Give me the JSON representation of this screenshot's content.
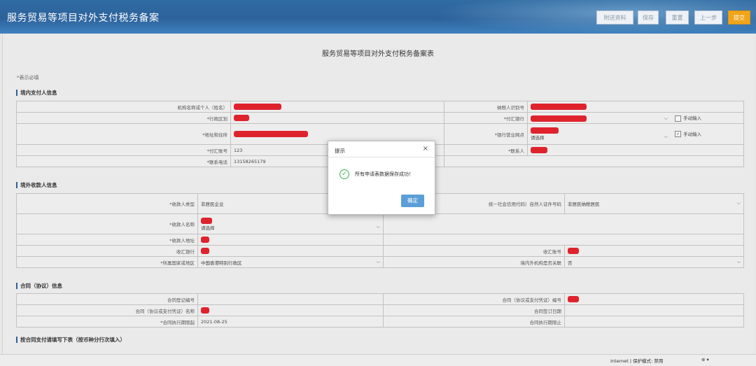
{
  "header": {
    "title": "服务贸易等项目对外支付税务备案",
    "buttons": [
      "附送资料",
      "保存",
      "重置",
      "上一步",
      "提交"
    ]
  },
  "form": {
    "title": "服务贸易等项目对外支付税务备案表",
    "required_note": "*表示必填"
  },
  "domestic": {
    "heading": "境内支付人信息",
    "payer_name_label": "机构名称或个人（姓名）",
    "taxpayer_id_label": "纳税人识别号",
    "region_label": "*行政区划",
    "payment_bank_label": "*付汇银行",
    "manual_input": "手动输入",
    "address_label": "*地址和住所",
    "bank_branch_label": "*银行营业网点",
    "bank_branch_value": "请选择",
    "account_label": "*付汇账号",
    "account_value": "123",
    "contact_label": "*联系人",
    "phone_label": "*联系电话",
    "phone_value": "13158265179"
  },
  "foreign": {
    "heading": "境外收款人信息",
    "payee_type_label": "*收款人类型",
    "payee_type_value": "非居民企业",
    "credit_code_label": "统一社会信用代码）自然人证件号码",
    "non_resident_value": "非居民纳税居民",
    "payee_name_label": "*收款人名称",
    "payee_name_select": "请选择",
    "payee_address_label": "*收款人地址",
    "receive_bank_label": "收汇银行",
    "receive_account_label": "收汇账号",
    "country_label": "*所属国家或地区",
    "country_value": "中国香港特别行政区",
    "related_label": "境内外机构是否关联",
    "related_value": "否"
  },
  "contract": {
    "heading": "合同（协议）信息",
    "reg_no_label": "合同登记编号",
    "contract_no_label": "合同（协议或支付凭证）编号",
    "contract_name_label": "合同（协议或支付凭证）名称",
    "sign_date_label": "合同签订日期",
    "start_label": "*合同执行期限起",
    "start_value": "2021-08-25",
    "end_label": "合同执行期限止"
  },
  "payment": {
    "heading": "按合同支付请填写下表（按币种分行次填入）"
  },
  "dialog": {
    "title": "提示",
    "close": "×",
    "message": "所有申请表数据保存成功！",
    "ok": "确定"
  },
  "statusbar": {
    "zone": "Internet | 保护模式: 禁用",
    "zoom": "⊕ ▾"
  },
  "colors": {
    "header": "#2a63a0",
    "submit": "#f0a51a",
    "redaction": "#e8202b",
    "success": "#3fb34f",
    "ok_button": "#5b9fd8"
  }
}
